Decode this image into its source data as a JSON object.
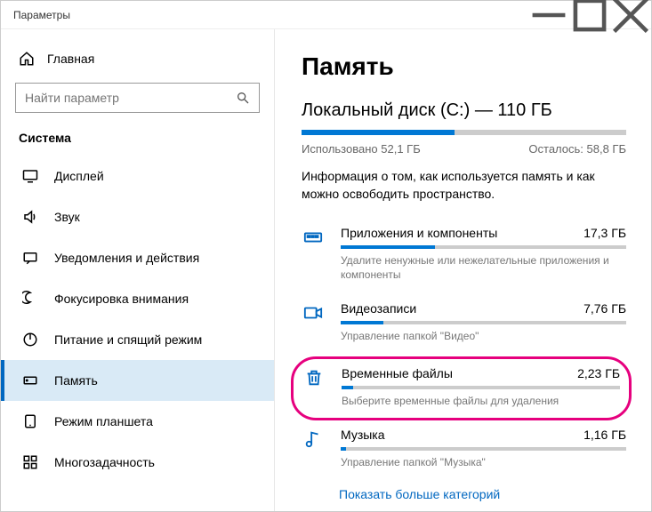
{
  "window": {
    "title": "Параметры"
  },
  "sidebar": {
    "home_label": "Главная",
    "search_placeholder": "Найти параметр",
    "group_title": "Система",
    "items": [
      {
        "label": "Дисплей"
      },
      {
        "label": "Звук"
      },
      {
        "label": "Уведомления и действия"
      },
      {
        "label": "Фокусировка внимания"
      },
      {
        "label": "Питание и спящий режим"
      },
      {
        "label": "Память"
      },
      {
        "label": "Режим планшета"
      },
      {
        "label": "Многозадачность"
      }
    ]
  },
  "page": {
    "title": "Память",
    "disk_title": "Локальный диск (C:) — 110 ГБ",
    "used_label": "Использовано 52,1 ГБ",
    "free_label": "Осталось: 58,8 ГБ",
    "disk_fill_pct": 47,
    "info_text": "Информация о том, как используется память и как можно освободить пространство.",
    "categories": [
      {
        "title": "Приложения и компоненты",
        "size": "17,3 ГБ",
        "sub": "Удалите ненужные или нежелательные приложения и компоненты",
        "pct": 33
      },
      {
        "title": "Видеозаписи",
        "size": "7,76 ГБ",
        "sub": "Управление папкой \"Видео\"",
        "pct": 15
      },
      {
        "title": "Временные файлы",
        "size": "2,23 ГБ",
        "sub": "Выберите временные файлы для удаления",
        "pct": 4
      },
      {
        "title": "Музыка",
        "size": "1,16 ГБ",
        "sub": "Управление папкой \"Музыка\"",
        "pct": 2
      }
    ],
    "more_link": "Показать больше категорий"
  }
}
